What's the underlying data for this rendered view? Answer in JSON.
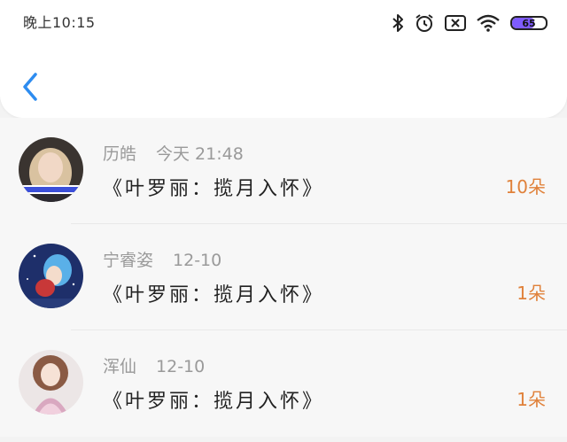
{
  "status_bar": {
    "time": "晚上10:15",
    "battery": "65",
    "battery_level": 0.65
  },
  "header": {
    "back_icon": "chevron-left-icon",
    "accent": "#2d8cf0"
  },
  "gifts": [
    {
      "name": "历皓",
      "time": "今天 21:48",
      "title": "《叶罗丽：揽月入怀》",
      "count": "10朵"
    },
    {
      "name": "宁睿姿",
      "time": "12-10",
      "title": "《叶罗丽：揽月入怀》",
      "count": "1朵"
    },
    {
      "name": "浑仙",
      "time": "12-10",
      "title": "《叶罗丽：揽月入怀》",
      "count": "1朵"
    }
  ],
  "colors": {
    "count": "#e0813a",
    "name": "#9a9a9a"
  }
}
